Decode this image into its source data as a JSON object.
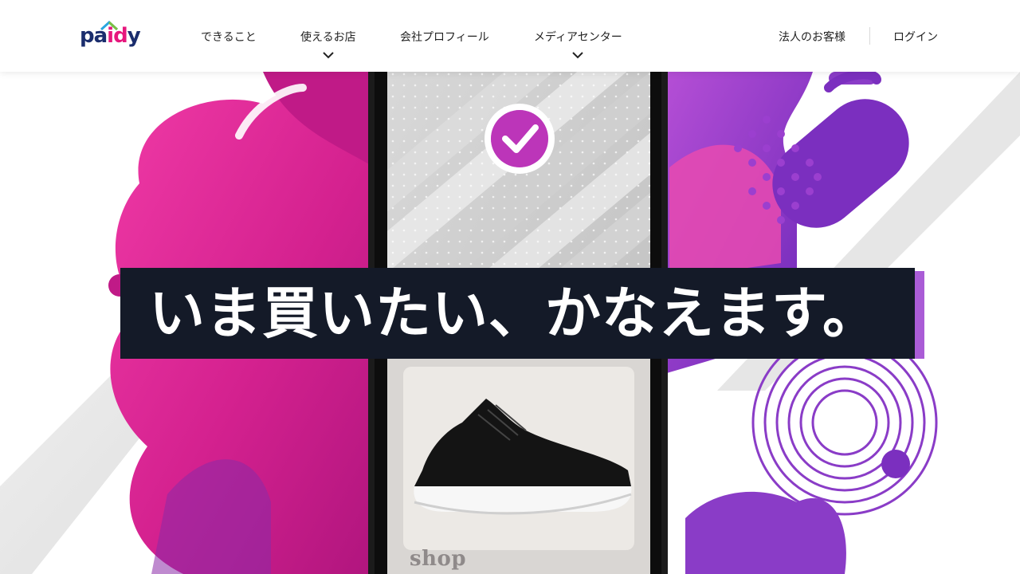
{
  "brand": {
    "logo_text_a": "pa",
    "logo_text_b": "id",
    "logo_text_c": "y",
    "colors": {
      "navy": "#1a2d6d",
      "pink": "#e6177d",
      "roof_blue": "#2aa6e0",
      "roof_green": "#7ac143"
    }
  },
  "nav": {
    "items": [
      {
        "label": "できること",
        "has_dropdown": false
      },
      {
        "label": "使えるお店",
        "has_dropdown": true
      },
      {
        "label": "会社プロフィール",
        "has_dropdown": false
      },
      {
        "label": "メディアセンター",
        "has_dropdown": true
      }
    ],
    "corporate_label": "法人のお客様",
    "login_label": "ログイン"
  },
  "hero": {
    "headline": "いま買いたい、かなえます。",
    "shop_label": "shop",
    "colors": {
      "magenta": "#d4218f",
      "purple": "#7b2fbf",
      "dark_bar": "#141a28"
    }
  }
}
